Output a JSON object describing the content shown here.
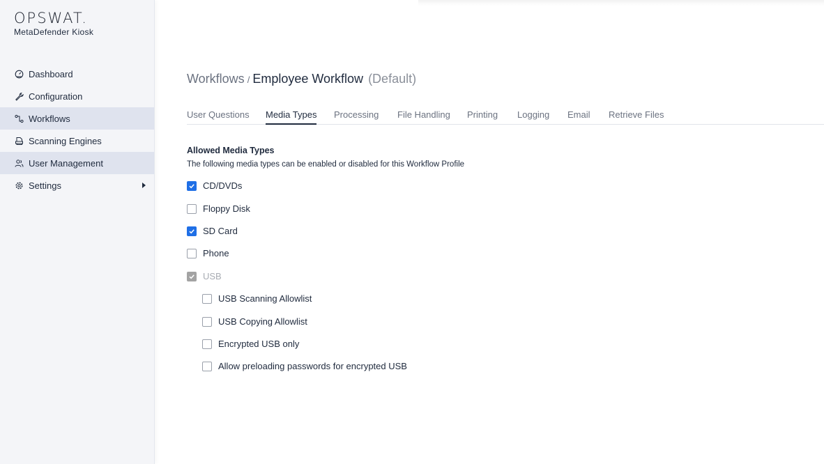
{
  "sidebar": {
    "logo": {
      "word": "OPSWAT.",
      "product": "MetaDefender Kiosk"
    },
    "items": [
      {
        "label": "Dashboard",
        "icon": "dashboard-icon",
        "active": false
      },
      {
        "label": "Configuration",
        "icon": "wrench-icon",
        "active": false
      },
      {
        "label": "Workflows",
        "icon": "workflow-icon",
        "active": true
      },
      {
        "label": "Scanning Engines",
        "icon": "engine-icon",
        "active": false
      },
      {
        "label": "User Management",
        "icon": "users-icon",
        "active": true
      },
      {
        "label": "Settings",
        "icon": "gear-icon",
        "active": false,
        "has_submenu": true
      }
    ]
  },
  "breadcrumb": {
    "parent": "Workflows",
    "separator": "/",
    "current": "Employee Workflow",
    "suffix": "(Default)"
  },
  "tabs": [
    {
      "label": "User Questions",
      "active": false
    },
    {
      "label": "Media Types",
      "active": true
    },
    {
      "label": "Processing",
      "active": false
    },
    {
      "label": "File Handling",
      "active": false
    },
    {
      "label": "Printing",
      "active": false
    },
    {
      "label": "Logging",
      "active": false
    },
    {
      "label": "Email",
      "active": false
    },
    {
      "label": "Retrieve Files",
      "active": false
    }
  ],
  "media_types": {
    "title": "Allowed Media Types",
    "description": "The following media types can be enabled or disabled for this Workflow Profile",
    "options": [
      {
        "label": "CD/DVDs",
        "checked": true,
        "disabled": false
      },
      {
        "label": "Floppy Disk",
        "checked": false,
        "disabled": false
      },
      {
        "label": "SD Card",
        "checked": true,
        "disabled": false
      },
      {
        "label": "Phone",
        "checked": false,
        "disabled": false
      },
      {
        "label": "USB",
        "checked": true,
        "disabled": true
      }
    ],
    "usb_options": [
      {
        "label": "USB Scanning Allowlist",
        "checked": false
      },
      {
        "label": "USB Copying Allowlist",
        "checked": false
      },
      {
        "label": "Encrypted USB only",
        "checked": false
      },
      {
        "label": "Allow preloading passwords for encrypted USB",
        "checked": false
      }
    ]
  },
  "colors": {
    "accent": "#1f6fe6",
    "sidebar_bg": "#f4f5f8",
    "sidebar_active": "#dfe3ee",
    "disabled_check": "#a3a3a3"
  }
}
